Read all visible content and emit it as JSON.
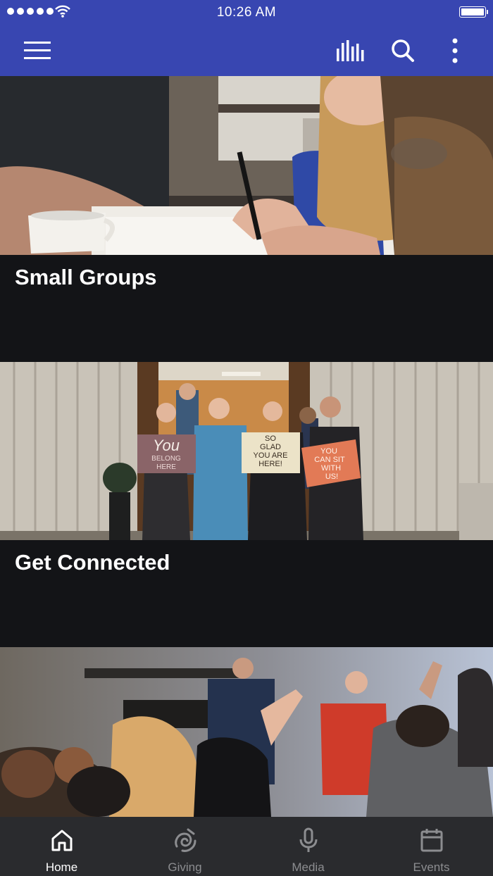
{
  "status_bar": {
    "time": "10:26 AM"
  },
  "app_bar": {
    "icons": [
      "menu-icon",
      "equalizer-icon",
      "search-icon",
      "more-vertical-icon"
    ]
  },
  "cards": [
    {
      "title": "Small Groups",
      "image": "people-writing-at-table-photo"
    },
    {
      "title": "Get Connected",
      "image": "group-holding-welcome-signs-photo",
      "signs": [
        "You",
        "BELONG",
        "HERE",
        "SO",
        "GLAD",
        "YOU ARE",
        "HERE!",
        "YOU",
        "CAN SIT",
        "WITH",
        "US!"
      ]
    },
    {
      "title": "",
      "image": "worship-service-photo"
    }
  ],
  "tabs": [
    {
      "label": "Home",
      "icon": "home-icon",
      "active": true
    },
    {
      "label": "Giving",
      "icon": "giving-icon",
      "active": false
    },
    {
      "label": "Media",
      "icon": "microphone-icon",
      "active": false
    },
    {
      "label": "Events",
      "icon": "calendar-icon",
      "active": false
    }
  ],
  "colors": {
    "primary": "#3846b1",
    "background": "#131417",
    "tabbar": "#2a2b2e",
    "tab_active": "#ffffff",
    "tab_inactive": "#8c8d90"
  }
}
